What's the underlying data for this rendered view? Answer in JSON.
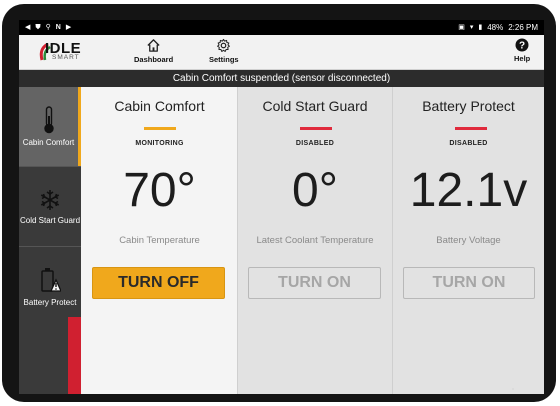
{
  "status_bar": {
    "time": "2:26 PM",
    "battery": "48%",
    "left_icons": [
      "back-arrow-icon",
      "shield-icon",
      "location-icon",
      "n-icon",
      "play-icon"
    ],
    "right_icons": [
      "cast-icon",
      "wifi-icon",
      "battery-icon"
    ]
  },
  "app_bar": {
    "logo_text": "IDLE",
    "logo_subtext": "SMART",
    "dashboard_label": "Dashboard",
    "settings_label": "Settings",
    "help_label": "Help"
  },
  "banner": {
    "message": "Cabin Comfort suspended (sensor disconnected)"
  },
  "sidebar": {
    "items": [
      {
        "label": "Cabin Comfort",
        "icon": "thermometer-icon",
        "active": true
      },
      {
        "label": "Cold Start Guard",
        "icon": "snowflake-icon",
        "active": false
      },
      {
        "label": "Battery Protect",
        "icon": "battery-warning-icon",
        "active": false
      }
    ]
  },
  "panels": [
    {
      "title": "Cabin Comfort",
      "status": "MONITORING",
      "value": "70°",
      "label": "Cabin Temperature",
      "button": "TURN OFF",
      "bar_color": "#f0a81c",
      "background": "#f4f4f4"
    },
    {
      "title": "Cold Start Guard",
      "status": "DISABLED",
      "value": "0°",
      "label": "Latest Coolant Temperature",
      "button": "TURN ON",
      "bar_color": "#e02a3c",
      "background": "#e2e2e2"
    },
    {
      "title": "Battery Protect",
      "status": "DISABLED",
      "value": "12.1v",
      "label": "Battery Voltage",
      "button": "TURN ON",
      "bar_color": "#e02a3c",
      "background": "#e2e2e2"
    }
  ]
}
